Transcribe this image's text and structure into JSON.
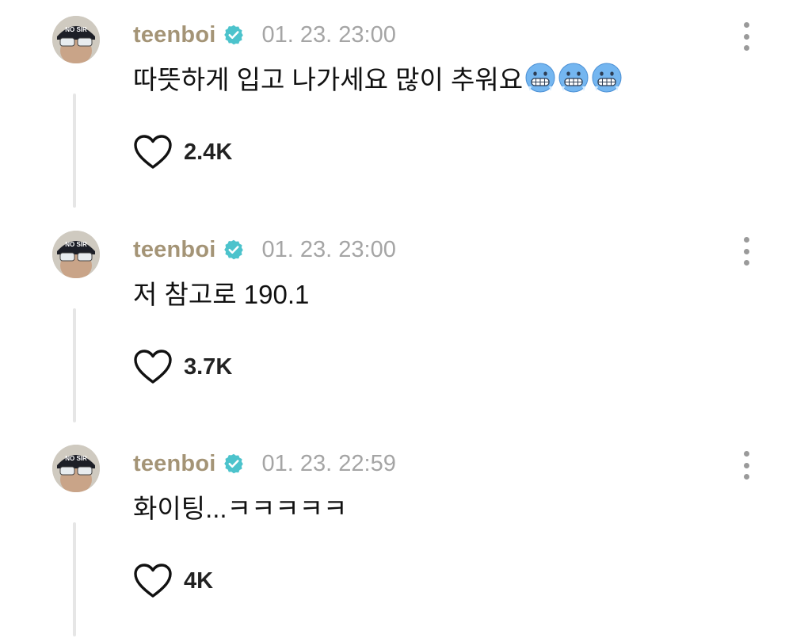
{
  "posts": [
    {
      "username": "teenboi",
      "timestamp": "01. 23. 23:00",
      "text": "따뜻하게 입고 나가세요 많이 추워요",
      "emoji_icons": [
        "cold-face-emoji",
        "cold-face-emoji",
        "cold-face-emoji"
      ],
      "likes": "2.4K"
    },
    {
      "username": "teenboi",
      "timestamp": "01. 23. 23:00",
      "text": "저 참고로 190.1",
      "emoji_icons": [],
      "likes": "3.7K"
    },
    {
      "username": "teenboi",
      "timestamp": "01. 23. 22:59",
      "text": "화이팅...ㅋㅋㅋㅋㅋ",
      "emoji_icons": [],
      "likes": "4K"
    }
  ],
  "avatar_cap_text": "NO SIR",
  "colors": {
    "username": "#a49476",
    "timestamp": "#a5a5a5",
    "verified_badge": "#4cc3cc",
    "thread_line": "#e6e6e6",
    "more_dots": "#9a9a9a",
    "emoji_face": "#74b6f0"
  },
  "icons": {
    "verified": "verified-badge-icon",
    "like": "heart-outline-icon",
    "more": "more-vertical-icon"
  }
}
